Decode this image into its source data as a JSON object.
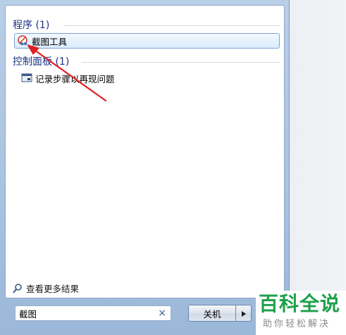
{
  "groups": {
    "programs": {
      "header": "程序 (1)",
      "items": [
        {
          "label": "截图工具",
          "icon": "snipping-tool-icon"
        }
      ]
    },
    "control_panel": {
      "header": "控制面板 (1)",
      "items": [
        {
          "label": "记录步骤以再现问题",
          "icon": "steps-recorder-icon"
        }
      ]
    }
  },
  "see_more": {
    "label": "查看更多结果",
    "icon": "magnifier-icon"
  },
  "search": {
    "value": "截图",
    "clear_icon": "×"
  },
  "shutdown": {
    "label": "关机",
    "arrow_icon": "triangle-right-icon"
  },
  "watermark": {
    "title": "百科全说",
    "subtitle": "助你轻松解决"
  },
  "colors": {
    "header_text": "#1e3287",
    "annotation_arrow": "#e02020",
    "watermark_green": "#1ea14a"
  }
}
